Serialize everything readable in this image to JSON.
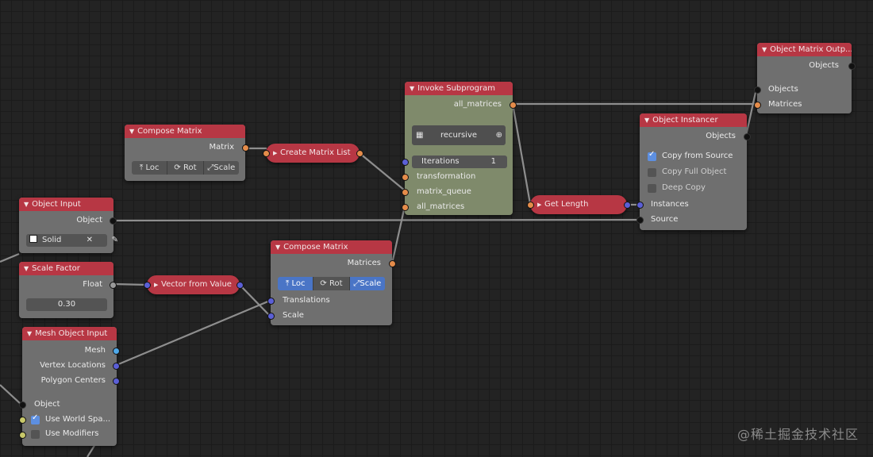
{
  "nodes": {
    "compose_matrix_1": {
      "title": "Compose Matrix",
      "output": "Matrix",
      "buttons": [
        "Loc",
        "Rot",
        "Scale"
      ]
    },
    "object_input": {
      "title": "Object Input",
      "output": "Object",
      "object_value": "Solid"
    },
    "scale_factor": {
      "title": "Scale Factor",
      "output": "Float",
      "value": "0.30"
    },
    "mesh_object_input": {
      "title": "Mesh Object Input",
      "outputs": [
        "Mesh",
        "Vertex Locations",
        "Polygon Centers"
      ],
      "input": "Object",
      "options": [
        "Use World Spa...",
        "Use Modifiers"
      ]
    },
    "create_matrix_list": {
      "title": "Create Matrix List"
    },
    "vector_from_value": {
      "title": "Vector from Value"
    },
    "compose_matrix_2": {
      "title": "Compose Matrix",
      "output": "Matrices",
      "buttons": [
        "Loc",
        "Rot",
        "Scale"
      ],
      "inputs": [
        "Translations",
        "Scale"
      ]
    },
    "invoke_subprogram": {
      "title": "Invoke Subprogram",
      "output": "all_matrices",
      "subprogram": "recursive",
      "iterations_label": "Iterations",
      "iterations_value": "1",
      "inputs": [
        "transformation",
        "matrix_queue",
        "all_matrices"
      ]
    },
    "get_length": {
      "title": "Get Length"
    },
    "object_instancer": {
      "title": "Object Instancer",
      "output": "Objects",
      "options": [
        "Copy from Source",
        "Copy Full Object",
        "Deep Copy"
      ],
      "inputs": [
        "Instances",
        "Source"
      ]
    },
    "object_matrix_output": {
      "title": "Object Matrix Outp...",
      "output": "Objects",
      "inputs": [
        "Objects",
        "Matrices"
      ]
    }
  },
  "watermark": "@稀土掘金技术社区",
  "colors": {
    "header": "#b73744",
    "node_body": "#6f6f6f",
    "subprogram_body": "#7f8a6b",
    "socket_matrix": "#e58c4a",
    "socket_vector": "#5b5fd6",
    "toggle_active": "#4a75c6"
  }
}
